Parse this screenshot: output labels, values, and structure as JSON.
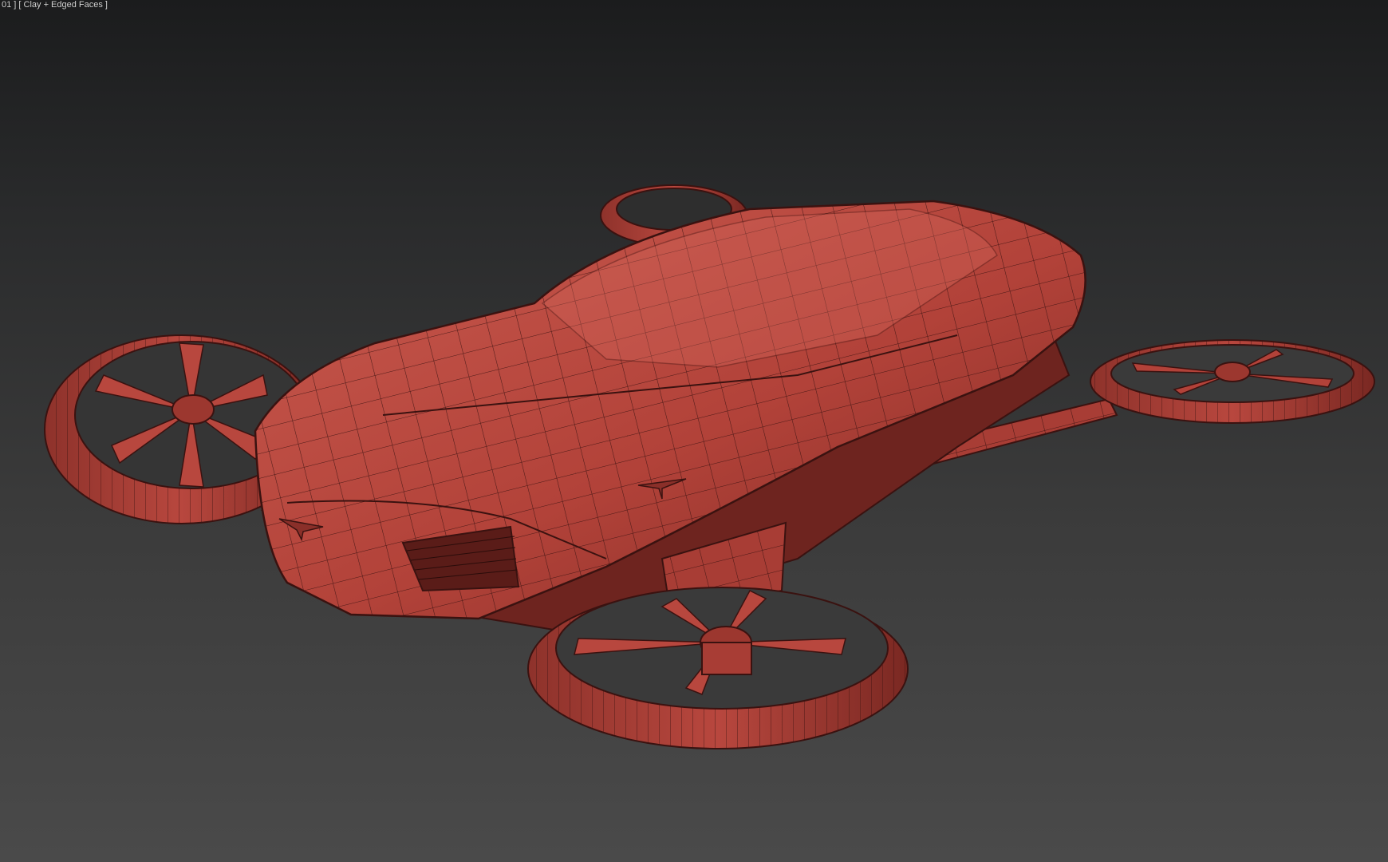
{
  "viewport": {
    "label": "01 ] [ Clay + Edged Faces ]",
    "background_top": "#1b1c1d",
    "background_bottom": "#4a4a4a"
  },
  "model": {
    "clay_color": "#b9483f",
    "edge_color": "#3a1210",
    "shade_color": "#7a2a25",
    "highlight_color": "#d4675c"
  }
}
